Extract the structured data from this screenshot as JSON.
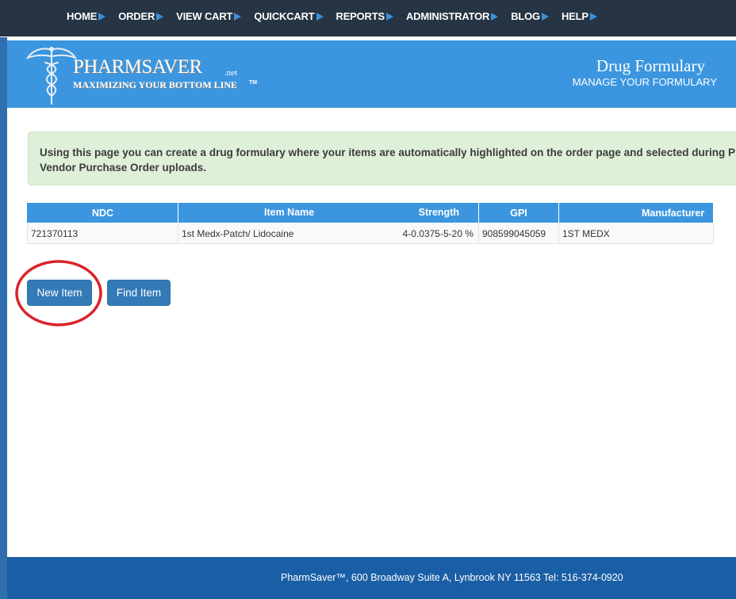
{
  "nav": {
    "items": [
      {
        "label": "HOME"
      },
      {
        "label": "ORDER"
      },
      {
        "label": "VIEW CART"
      },
      {
        "label": "QUICKCART"
      },
      {
        "label": "REPORTS"
      },
      {
        "label": "ADMINISTRATOR"
      },
      {
        "label": "BLOG"
      },
      {
        "label": "HELP"
      }
    ]
  },
  "header": {
    "logo": {
      "brand": "PHARMSAVER",
      "suffix": ".net",
      "tagline": "MAXIMIZING YOUR BOTTOM LINE",
      "tm": "TM"
    },
    "title": "Drug Formulary",
    "subtitle": "MANAGE YOUR FORMULARY"
  },
  "info": {
    "text": "Using this page you can create a drug formulary where your items are automatically highlighted on the order page and selected during Prime Vendor Purchase Order uploads."
  },
  "table": {
    "headers": {
      "ndc": "NDC",
      "item_name": "Item Name",
      "strength": "Strength",
      "gpi": "GPI",
      "manufacturer": "Manufacturer"
    },
    "rows": [
      {
        "ndc": "721370113",
        "item_name": "1st Medx-Patch/ Lidocaine",
        "strength": "4-0.0375-5-20 %",
        "gpi": "908599045059",
        "manufacturer": "1ST MEDX"
      }
    ]
  },
  "actions": {
    "new_item": "New Item",
    "find_item": "Find Item"
  },
  "footer": {
    "text": "PharmSaver™, 600 Broadway Suite A, Lynbrook NY 11563 Tel: 516-374-0920"
  },
  "colors": {
    "nav_bg": "#263444",
    "nav_arrow": "#3d8fd6",
    "header_bg": "#3b96df",
    "info_bg": "#dff0d8",
    "button_bg": "#337ab7",
    "footer_bg": "#1a5fa5",
    "annotation": "#d9232a"
  }
}
